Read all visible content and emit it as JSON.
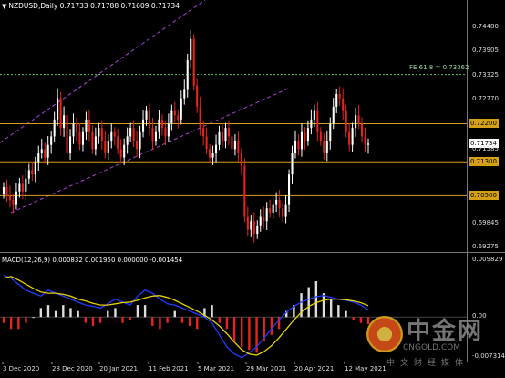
{
  "window": {
    "symbol_header": "NZDUSD,Daily  0.71733 0.71788 0.71609 0.71734",
    "macd_header": "MACD(12,26,9) 0.000832 0.001950 0.000000 -0.001454",
    "fib_label": "FE 61.8 = 0.73362"
  },
  "colors": {
    "background": "#000000",
    "bull": "#ffffff",
    "bear": "#e8231c",
    "level": "#d4a017",
    "channel": "#b040e0",
    "fib": "#6fbf6f",
    "macd_line": "#1f3cff",
    "signal_line": "#e6d200",
    "grid": "#333333"
  },
  "price_axis": {
    "labels": [
      "0.74480",
      "0.73905",
      "0.73325",
      "0.72770",
      "0.72200",
      "0.71585",
      "0.71734",
      "0.71300",
      "0.70500",
      "0.69845",
      "0.69275"
    ]
  },
  "level_tags": [
    {
      "label": "0.72200",
      "value": 0.722
    },
    {
      "label": "0.71300",
      "value": 0.713
    },
    {
      "label": "0.70500",
      "value": 0.705
    }
  ],
  "current_price": {
    "label": "0.71734",
    "value": 0.71734
  },
  "macd_axis": {
    "labels": [
      "0.009829",
      "0.00",
      "-0.007314"
    ]
  },
  "time_axis": {
    "labels": [
      "3 Dec 2020",
      "28 Dec 2020",
      "20 Jan 2021",
      "11 Feb 2021",
      "5 Mar 2021",
      "29 Mar 2021",
      "20 Apr 2021",
      "12 May 2021"
    ]
  },
  "logo": {
    "brand_cn": "中金网",
    "domain": "CNGOLD.COM",
    "tagline_cn": "中文财经媒体"
  },
  "chart_data": {
    "type": "candlestick",
    "symbol": "NZDUSD",
    "timeframe": "Daily",
    "ylim": [
      0.6915,
      0.7512
    ],
    "horizontal_levels": [
      0.722,
      0.713,
      0.705
    ],
    "fib_level": 0.73362,
    "closes": [
      0.707,
      0.705,
      0.704,
      0.703,
      0.706,
      0.708,
      0.706,
      0.709,
      0.711,
      0.71,
      0.713,
      0.715,
      0.716,
      0.714,
      0.717,
      0.719,
      0.723,
      0.728,
      0.721,
      0.724,
      0.715,
      0.719,
      0.722,
      0.72,
      0.717,
      0.72,
      0.723,
      0.72,
      0.716,
      0.719,
      0.721,
      0.718,
      0.715,
      0.718,
      0.72,
      0.719,
      0.716,
      0.714,
      0.717,
      0.719,
      0.721,
      0.718,
      0.716,
      0.72,
      0.723,
      0.725,
      0.721,
      0.718,
      0.72,
      0.723,
      0.721,
      0.719,
      0.722,
      0.725,
      0.724,
      0.723,
      0.728,
      0.73,
      0.737,
      0.742,
      0.731,
      0.726,
      0.721,
      0.719,
      0.716,
      0.714,
      0.715,
      0.717,
      0.72,
      0.718,
      0.721,
      0.719,
      0.716,
      0.718,
      0.715,
      0.712,
      0.7,
      0.697,
      0.699,
      0.696,
      0.698,
      0.7,
      0.699,
      0.702,
      0.701,
      0.703,
      0.704,
      0.702,
      0.7,
      0.703,
      0.71,
      0.715,
      0.718,
      0.716,
      0.72,
      0.718,
      0.721,
      0.723,
      0.725,
      0.72,
      0.718,
      0.715,
      0.718,
      0.722,
      0.726,
      0.729,
      0.728,
      0.725,
      0.72,
      0.717,
      0.721,
      0.724,
      0.722,
      0.719,
      0.717,
      0.7173
    ],
    "macd": {
      "histogram": [
        -0.001,
        -0.002,
        -0.002,
        -0.001,
        0.0,
        0.0015,
        0.002,
        0.001,
        0.002,
        0.0015,
        0.001,
        -0.001,
        -0.0015,
        -0.001,
        0.001,
        0.0015,
        -0.001,
        -0.0005,
        0.002,
        0.002,
        -0.0015,
        -0.002,
        -0.001,
        0.001,
        -0.001,
        -0.0015,
        -0.002,
        0.0015,
        0.002,
        -0.001,
        -0.002,
        -0.004,
        -0.005,
        -0.0055,
        -0.006,
        -0.004,
        -0.003,
        -0.002,
        0.001,
        0.002,
        0.004,
        0.005,
        0.006,
        0.004,
        0.003,
        0.002,
        0.001,
        -0.0005,
        -0.001,
        -0.0012
      ],
      "main": [
        0.007,
        0.0065,
        0.0055,
        0.0045,
        0.004,
        0.0035,
        0.0045,
        0.004,
        0.0035,
        0.003,
        0.0025,
        0.002,
        0.0018,
        0.0015,
        0.0022,
        0.003,
        0.0025,
        0.002,
        0.0035,
        0.0045,
        0.004,
        0.003,
        0.0022,
        0.002,
        0.0015,
        0.001,
        0.0005,
        0.0,
        -0.001,
        -0.003,
        -0.005,
        -0.0062,
        -0.0068,
        -0.006,
        -0.005,
        -0.0035,
        -0.002,
        -0.0005,
        0.0008,
        0.0018,
        0.0025,
        0.003,
        0.0034,
        0.0036,
        0.0033,
        0.003,
        0.0028,
        0.0025,
        0.002,
        0.0012
      ],
      "signal": [
        0.0065,
        0.0068,
        0.0062,
        0.0055,
        0.0048,
        0.0042,
        0.004,
        0.004,
        0.0038,
        0.0035,
        0.003,
        0.0027,
        0.0023,
        0.002,
        0.002,
        0.0022,
        0.0024,
        0.0025,
        0.0028,
        0.0032,
        0.0035,
        0.0036,
        0.0033,
        0.0028,
        0.0022,
        0.0016,
        0.001,
        0.0003,
        -0.0005,
        -0.0015,
        -0.0028,
        -0.0042,
        -0.0055,
        -0.0062,
        -0.0064,
        -0.0058,
        -0.0048,
        -0.0035,
        -0.002,
        -0.0005,
        0.0008,
        0.0018,
        0.0024,
        0.0028,
        0.003,
        0.003,
        0.0029,
        0.0027,
        0.0024,
        0.0019
      ]
    }
  }
}
